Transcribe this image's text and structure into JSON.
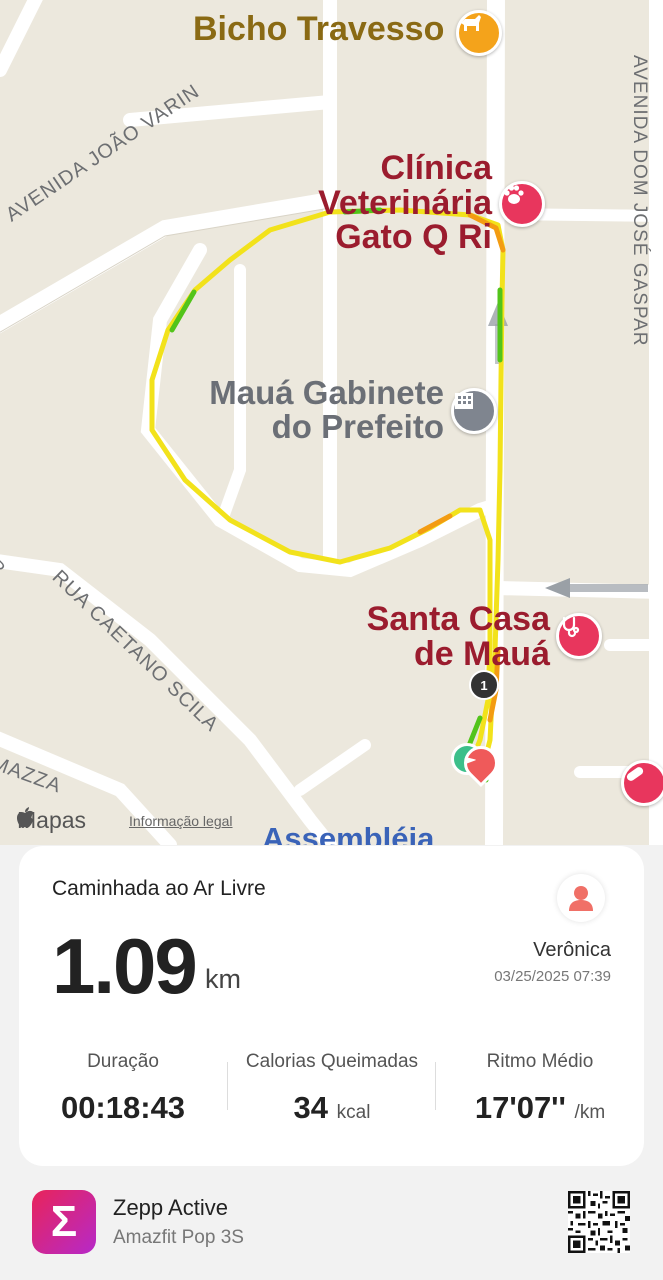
{
  "map": {
    "pois": {
      "bicho_travesso": "Bicho Travesso",
      "clinica_line1": "Clínica",
      "clinica_line2": "Veterinária",
      "clinica_line3": "Gato Q Ri",
      "gabinete_line1": "Mauá Gabinete",
      "gabinete_line2": "do Prefeito",
      "santa_casa_line1": "Santa Casa",
      "santa_casa_line2": "de Mauá",
      "assembleia": "Assembléia"
    },
    "streets": {
      "avenida_joao_varin": "AVENIDA JOÃO VARIN",
      "rua_caetano_scila": "RUA CAETANO SCILA",
      "mazza": "MAZZA",
      "right_avenue": "AVENIDA DOM JOSÉ GASPAR",
      "left_edge": "R"
    },
    "marker_number": "1",
    "attribution": "Mapas",
    "legal_link": "Informação legal"
  },
  "card": {
    "activity_title": "Caminhada ao Ar Livre",
    "distance_value": "1.09",
    "distance_unit": "km",
    "user_name": "Verônica",
    "timestamp": "03/25/2025 07:39",
    "stats": [
      {
        "label": "Duração",
        "value": "00:18:43",
        "unit": ""
      },
      {
        "label": "Calorias Queimadas",
        "value": "34",
        "unit": "kcal"
      },
      {
        "label": "Ritmo Médio",
        "value": "17'07''",
        "unit": "/km"
      }
    ]
  },
  "footer": {
    "app_name": "Zepp Active",
    "device_name": "Amazfit Pop 3S",
    "app_logo_glyph": "Σ"
  },
  "icons": {
    "bicho_pin": "dog-icon",
    "clinica_pin": "paw-icon",
    "gabinete_pin": "building-icon",
    "santa_casa_pin": "stethoscope-icon",
    "pharmacy_pin": "pill-icon",
    "avatar": "person-icon",
    "apple": "apple-logo-icon",
    "qr": "qr-code-icon"
  },
  "colors": {
    "route_main": "#f2e21b",
    "route_fast": "#52c41a",
    "route_slow": "#f39c12",
    "poi_red": "#9b1c2e",
    "poi_brown": "#8a6a14",
    "pin_pink": "#e8365d",
    "pin_orange": "#f4a31b",
    "pin_gray": "#7f858f"
  }
}
